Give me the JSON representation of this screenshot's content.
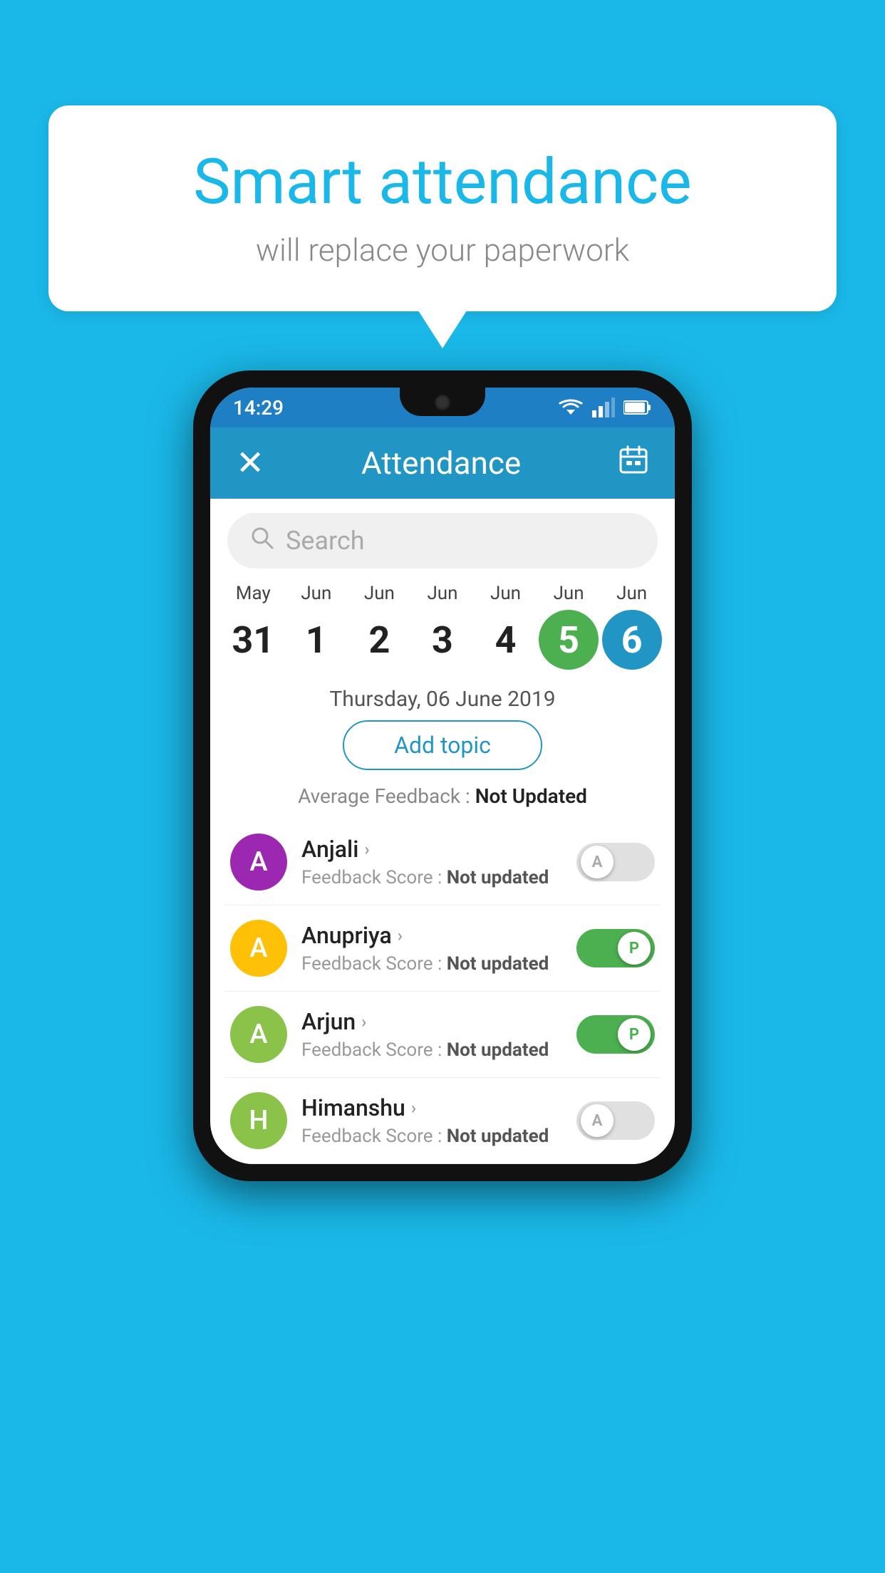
{
  "background_color": "#1ab8e8",
  "bubble": {
    "title": "Smart attendance",
    "subtitle": "will replace your paperwork"
  },
  "status_bar": {
    "time": "14:29"
  },
  "header": {
    "title": "Attendance",
    "close_label": "✕",
    "calendar_label": "📅"
  },
  "search": {
    "placeholder": "Search"
  },
  "calendar": {
    "days": [
      {
        "month": "May",
        "date": "31",
        "state": "normal"
      },
      {
        "month": "Jun",
        "date": "1",
        "state": "normal"
      },
      {
        "month": "Jun",
        "date": "2",
        "state": "normal"
      },
      {
        "month": "Jun",
        "date": "3",
        "state": "normal"
      },
      {
        "month": "Jun",
        "date": "4",
        "state": "normal"
      },
      {
        "month": "Jun",
        "date": "5",
        "state": "today"
      },
      {
        "month": "Jun",
        "date": "6",
        "state": "selected"
      }
    ]
  },
  "selected_date": "Thursday, 06 June 2019",
  "add_topic_label": "Add topic",
  "avg_feedback_label": "Average Feedback :",
  "avg_feedback_value": "Not Updated",
  "students": [
    {
      "name": "Anjali",
      "avatar_letter": "A",
      "avatar_color": "#9c27b0",
      "feedback_label": "Feedback Score :",
      "feedback_value": "Not updated",
      "attendance": "absent"
    },
    {
      "name": "Anupriya",
      "avatar_letter": "A",
      "avatar_color": "#ffc107",
      "feedback_label": "Feedback Score :",
      "feedback_value": "Not updated",
      "attendance": "present"
    },
    {
      "name": "Arjun",
      "avatar_letter": "A",
      "avatar_color": "#8bc34a",
      "feedback_label": "Feedback Score :",
      "feedback_value": "Not updated",
      "attendance": "present"
    },
    {
      "name": "Himanshu",
      "avatar_letter": "H",
      "avatar_color": "#8bc34a",
      "feedback_label": "Feedback Score :",
      "feedback_value": "Not updated",
      "attendance": "absent"
    }
  ]
}
